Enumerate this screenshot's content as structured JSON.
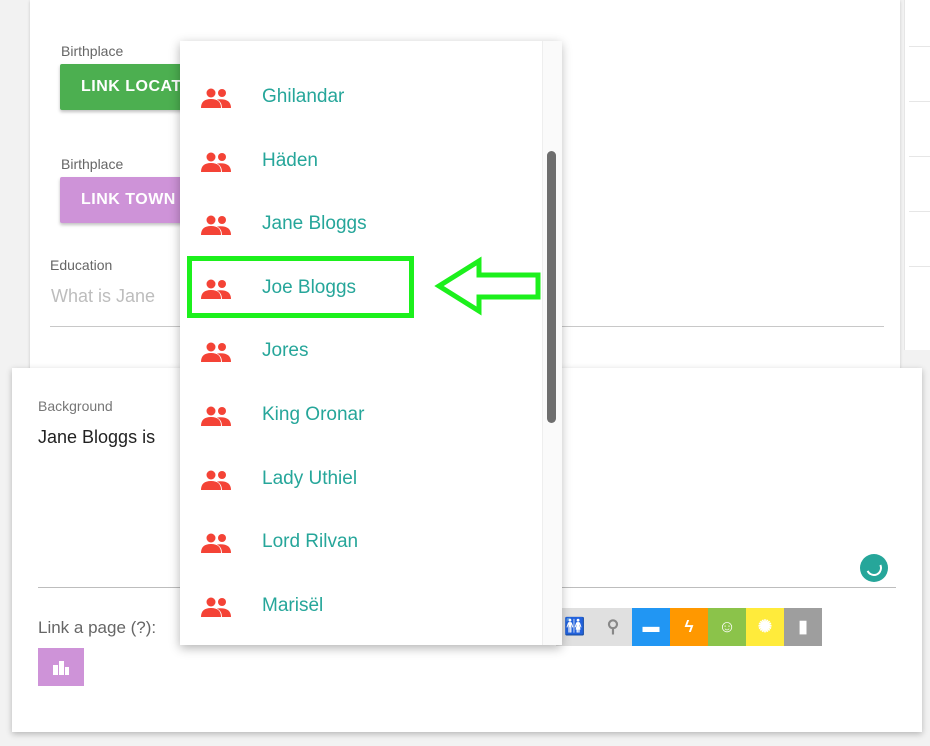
{
  "form": {
    "birthplace_label_1": "Birthplace",
    "link_location_button": "LINK LOCATION",
    "birthplace_label_2": "Birthplace",
    "link_town_button": "LINK TOWN",
    "education_label": "Education",
    "education_placeholder": "What is Jane",
    "colors": {
      "location_button": "#4caf50",
      "town_button": "#ce93d8"
    }
  },
  "background": {
    "label": "Background",
    "text": "Jane Bloggs is",
    "link_page_label": "Link a page (?):"
  },
  "type_icons": [
    {
      "name": "family-icon",
      "glyph": "🚻",
      "color": "#e0e0e0"
    },
    {
      "name": "location-pin-icon",
      "glyph": "⚲",
      "color": "#e0e0e0"
    },
    {
      "name": "chat-icon",
      "glyph": "▬",
      "color": "#2196f3"
    },
    {
      "name": "bolt-icon",
      "glyph": "ϟ",
      "color": "#ff9800"
    },
    {
      "name": "face-icon",
      "glyph": "☺",
      "color": "#8bc34a"
    },
    {
      "name": "sun-icon",
      "glyph": "✺",
      "color": "#ffeb3b"
    },
    {
      "name": "book-icon",
      "glyph": "▮",
      "color": "#9e9e9e"
    }
  ],
  "dropdown": {
    "items": [
      {
        "label": "Ghilandar"
      },
      {
        "label": "Häden"
      },
      {
        "label": "Jane Bloggs"
      },
      {
        "label": "Joe Bloggs",
        "highlighted": true
      },
      {
        "label": "Jores"
      },
      {
        "label": "King Oronar"
      },
      {
        "label": "Lady Uthiel"
      },
      {
        "label": "Lord Rilvan"
      },
      {
        "label": "Marisël"
      }
    ],
    "icon": "people-icon",
    "icon_color": "#f44336",
    "label_color": "#26a69a"
  },
  "annotation": {
    "highlight_color": "#1cf01c"
  }
}
